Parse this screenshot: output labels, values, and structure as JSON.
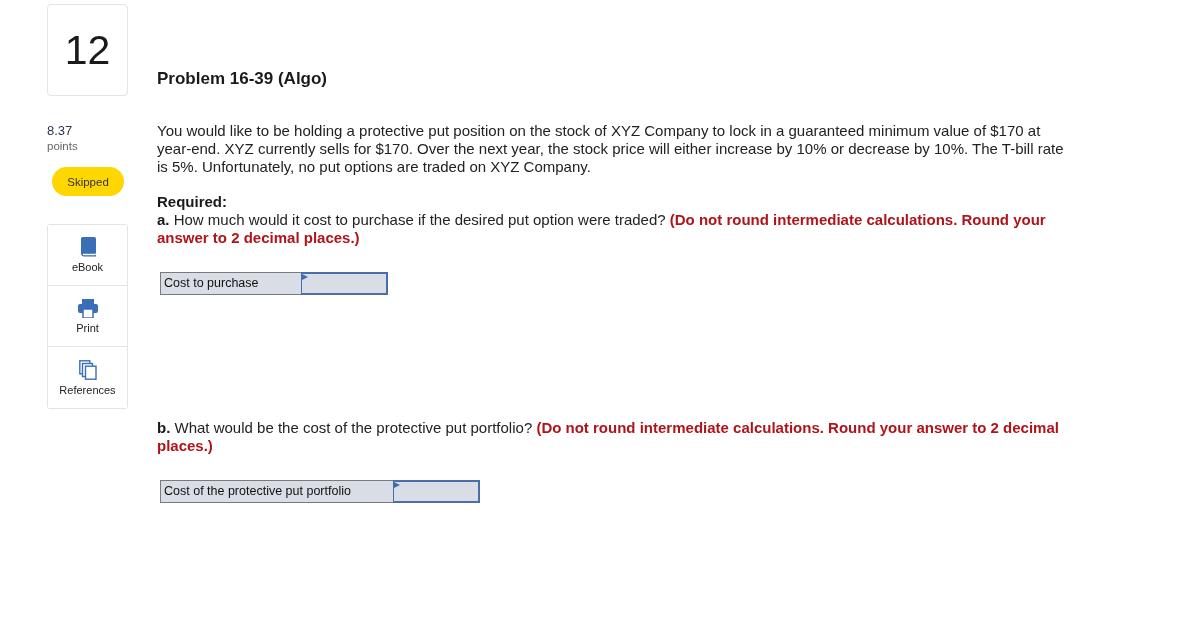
{
  "question_number": "12",
  "score": {
    "value": "8.37",
    "unit": "points"
  },
  "status": {
    "label": "Skipped"
  },
  "tools": [
    {
      "kind": "ebook",
      "label": "eBook"
    },
    {
      "kind": "print",
      "label": "Print"
    },
    {
      "kind": "references",
      "label": "References"
    }
  ],
  "problem": {
    "title": "Problem 16-39 (Algo)",
    "intro": "You would like to be holding a protective put position on the stock of XYZ Company to lock in a guaranteed minimum value of $170 at year-end. XYZ currently sells for $170. Over the next year, the stock price will either increase by 10% or decrease by 10%. The T-bill rate is 5%. Unfortunately, no put options are traded on XYZ Company.",
    "required_label": "Required:",
    "parts": [
      {
        "label": "a.",
        "question": "How much would it cost to purchase if the desired put option were traded?",
        "instruction": "(Do not round intermediate calculations. Round your answer to 2 decimal places.)",
        "answer_row": {
          "label": "Cost to purchase"
        }
      },
      {
        "label": "b.",
        "question": "What would be the cost of the protective put portfolio?",
        "instruction": "(Do not round intermediate calculations. Round your answer to 2 decimal places.)",
        "answer_row": {
          "label": "Cost of the protective put portfolio"
        }
      }
    ]
  }
}
